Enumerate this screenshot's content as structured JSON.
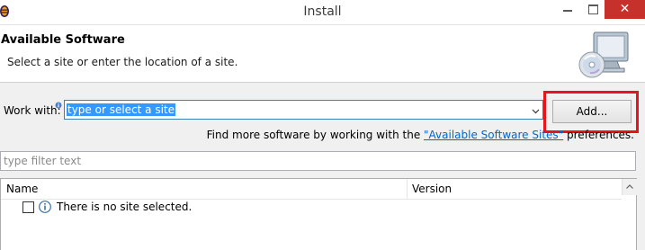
{
  "window": {
    "title": "Install"
  },
  "header": {
    "title": "Available Software",
    "description": "Select a site or enter the location of a site."
  },
  "work_with": {
    "label": "Work with:",
    "value": "type or select a site",
    "add_label": "Add..."
  },
  "find_more": {
    "prefix": "Find more software by working with the ",
    "link": "\"Available Software Sites\"",
    "suffix": " preferences."
  },
  "filter": {
    "placeholder": "type filter text"
  },
  "table": {
    "columns": [
      "Name",
      "Version"
    ],
    "rows": [
      {
        "name": "There is no site selected.",
        "version": "",
        "checked": false
      }
    ]
  },
  "colors": {
    "accent": "#3399ff",
    "close": "#c7312b",
    "highlight": "#e8141b",
    "link": "#0066cc"
  }
}
